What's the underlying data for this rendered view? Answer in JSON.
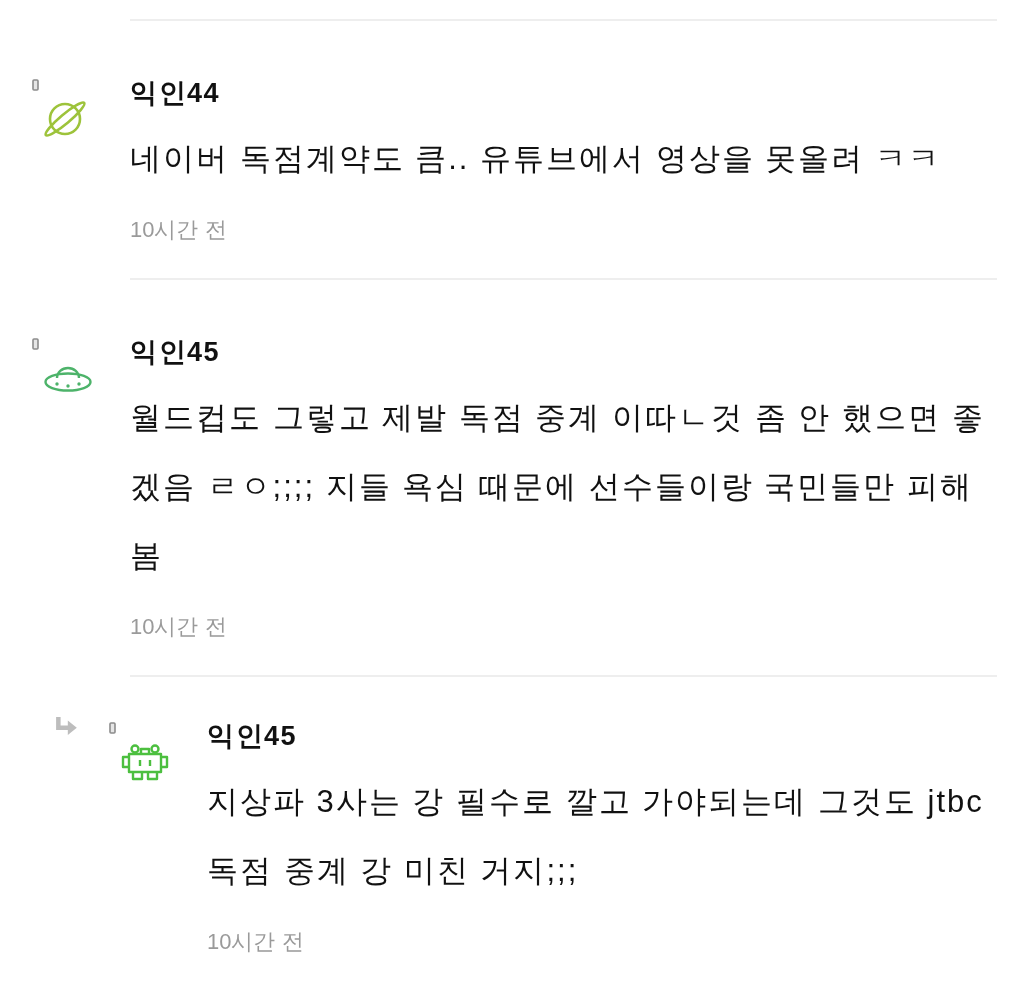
{
  "comments": [
    {
      "author": "익인44",
      "avatar": {
        "kind": "planet",
        "color": "#9dc33b"
      },
      "body": "네이버 독점계약도 큼.. 유튜브에서 영상을 못올려 ㅋㅋ",
      "time": "10시간 전"
    },
    {
      "author": "익인45",
      "avatar": {
        "kind": "ufo",
        "color": "#4db36a"
      },
      "body": "월드컵도 그렇고 제발 독점 중계 이따ㄴ것 좀 안 했으면 좋겠음 ㄹㅇ;;;; 지들 욕심 때문에 선수들이랑 국민들만 피해봄",
      "time": "10시간 전",
      "children": [
        {
          "author": "익인45",
          "avatar": {
            "kind": "invader",
            "color": "#4cbf3f"
          },
          "body": "지상파 3사는 강 필수로 깔고 가야되는데 그것도 jtbc 독점 중계 강 미친 거지;;;",
          "time": "10시간 전"
        }
      ]
    }
  ]
}
